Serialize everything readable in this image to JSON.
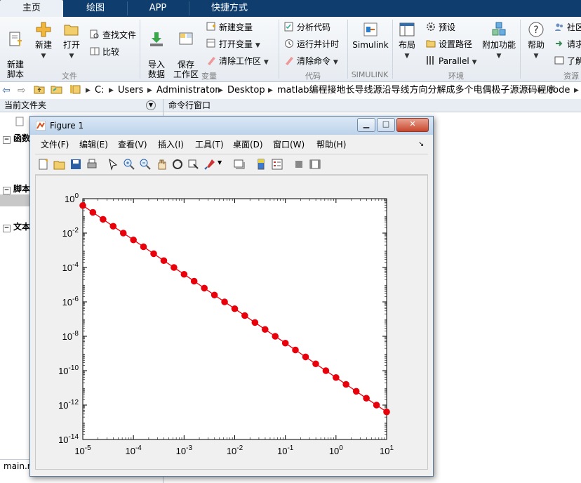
{
  "tabs": [
    "主页",
    "绘图",
    "APP",
    "快捷方式"
  ],
  "ribbon": {
    "file": {
      "new_script": "新建\n脚本",
      "new": "新建",
      "open": "打开",
      "find_files": "查找文件",
      "compare": "比较",
      "group": "文件"
    },
    "variable": {
      "import": "导入\n数据",
      "save_ws": "保存\n工作区",
      "new_var": "新建变量",
      "open_var": "打开变量",
      "clear_ws": "清除工作区",
      "group": "变量"
    },
    "code": {
      "analyze": "分析代码",
      "run_time": "运行并计时",
      "clear_cmd": "清除命令",
      "group": "代码"
    },
    "simulink": {
      "label": "Simulink",
      "group": "SIMULINK"
    },
    "env": {
      "layout": "布局",
      "prefs": "预设",
      "set_path": "设置路径",
      "parallel": "Parallel",
      "addons": "附加功能",
      "group": "环境"
    },
    "resources": {
      "help": "帮助",
      "community": "社区",
      "request": "请求",
      "learn": "了解",
      "group": "资源"
    }
  },
  "address": {
    "crumbs": [
      "C:",
      "Users",
      "Administrator",
      "Desktop",
      "matlab编程接地长导线源沿导线方向分解成多个电偶极子源源码程序",
      "code"
    ]
  },
  "left_panel": {
    "title": "当前文件夹",
    "sections": [
      "函数",
      "脚本",
      "文本"
    ],
    "bottom_file": "main.m"
  },
  "command_window": {
    "title": "命令行窗口"
  },
  "figure": {
    "title": "Figure 1",
    "menus": [
      "文件(F)",
      "编辑(E)",
      "查看(V)",
      "插入(I)",
      "工具(T)",
      "桌面(D)",
      "窗口(W)",
      "帮助(H)"
    ]
  },
  "colors": {
    "tab_bar": "#0e3d6e",
    "series": "#e8000b",
    "active_tab": "#eaf0f6"
  },
  "chart_data": {
    "type": "line",
    "xscale": "log",
    "yscale": "log",
    "xlim": [
      1e-05,
      10
    ],
    "ylim": [
      1e-14,
      1
    ],
    "xticks": [
      1e-05,
      0.0001,
      0.001,
      0.01,
      0.1,
      1,
      10
    ],
    "yticks": [
      1e-14,
      1e-12,
      1e-10,
      1e-08,
      1e-06,
      0.0001,
      0.01,
      1
    ],
    "xtick_labels": [
      {
        "b": "10",
        "e": "-5"
      },
      {
        "b": "10",
        "e": "-4"
      },
      {
        "b": "10",
        "e": "-3"
      },
      {
        "b": "10",
        "e": "-2"
      },
      {
        "b": "10",
        "e": "-1"
      },
      {
        "b": "10",
        "e": "0"
      },
      {
        "b": "10",
        "e": "1"
      }
    ],
    "ytick_labels": [
      {
        "b": "10",
        "e": "-14"
      },
      {
        "b": "10",
        "e": "-12"
      },
      {
        "b": "10",
        "e": "-10"
      },
      {
        "b": "10",
        "e": "-8"
      },
      {
        "b": "10",
        "e": "-6"
      },
      {
        "b": "10",
        "e": "-4"
      },
      {
        "b": "10",
        "e": "-2"
      },
      {
        "b": "10",
        "e": "0"
      }
    ],
    "series": [
      {
        "marker": "circle",
        "color": "#e8000b",
        "x": [
          1e-05,
          1.58e-05,
          2.51e-05,
          3.98e-05,
          6.31e-05,
          0.0001,
          0.000158,
          0.000251,
          0.000398,
          0.000631,
          0.001,
          0.00158,
          0.00251,
          0.00398,
          0.00631,
          0.01,
          0.0158,
          0.0251,
          0.0398,
          0.0631,
          0.1,
          0.158,
          0.251,
          0.398,
          0.631,
          1,
          1.58,
          2.51,
          3.98,
          6.31,
          10
        ],
        "y": [
          0.4,
          0.16,
          0.063,
          0.025,
          0.01,
          0.004,
          0.0016,
          0.00063,
          0.00025,
          0.0001,
          4e-05,
          1.6e-05,
          6.3e-06,
          2.5e-06,
          1e-06,
          4e-07,
          1.6e-07,
          6.3e-08,
          2.5e-08,
          1e-08,
          4e-09,
          1.6e-09,
          6.3e-10,
          2.5e-10,
          1e-10,
          4e-11,
          1.6e-11,
          6.3e-12,
          2.5e-12,
          1e-12,
          4e-13
        ]
      }
    ],
    "grid": false,
    "box": true
  }
}
